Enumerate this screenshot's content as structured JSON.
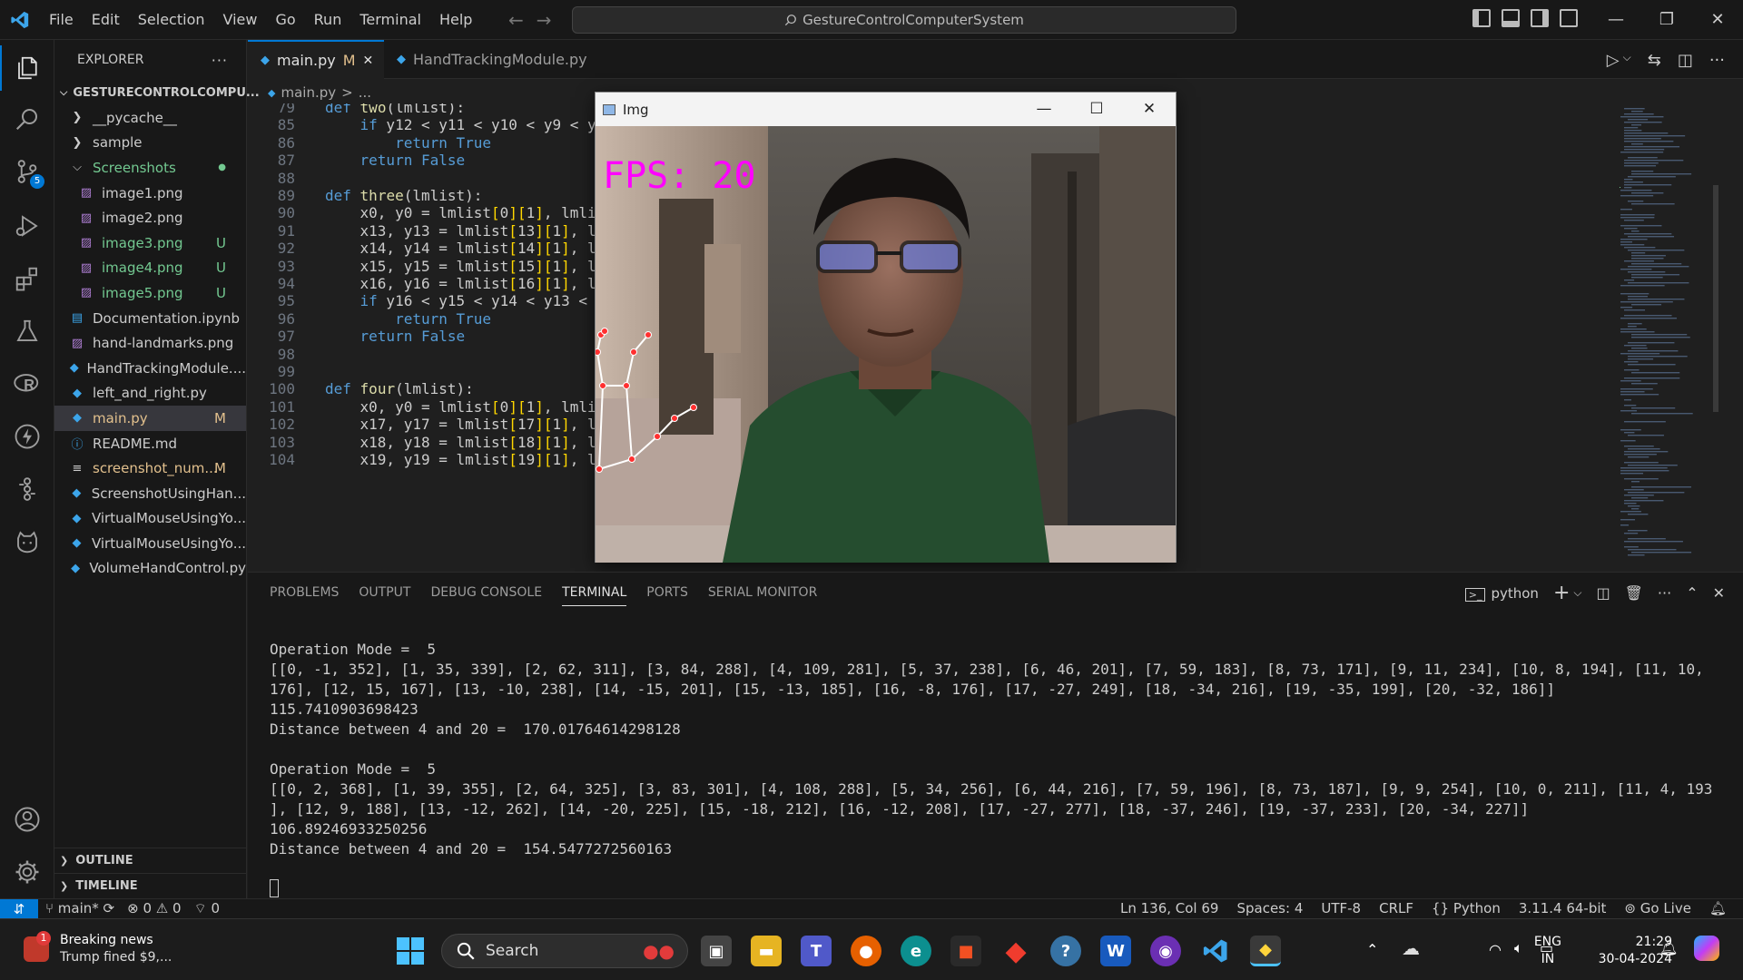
{
  "titlebar": {
    "menus": [
      "File",
      "Edit",
      "Selection",
      "View",
      "Go",
      "Run",
      "Terminal",
      "Help"
    ],
    "command_center": "GestureControlComputerSystem"
  },
  "activity_bar": {
    "icons": [
      "explorer-icon",
      "search-icon",
      "source-control-icon",
      "run-debug-icon",
      "extensions-icon",
      "testing-icon",
      "remote-r-icon",
      "thunder-icon",
      "git-graph-icon",
      "github-cat-icon",
      "account-icon",
      "settings-gear-icon"
    ],
    "source_control_badge": "5"
  },
  "sidebar": {
    "title": "EXPLORER",
    "more": "···",
    "folder": "GESTURECONTROLCOMPU...",
    "items": [
      {
        "label": "__pycache__",
        "type": "folder-collapsed",
        "depth": 1,
        "color": "#cccccc",
        "badge": ""
      },
      {
        "label": "sample",
        "type": "folder-collapsed",
        "depth": 1,
        "color": "#cccccc",
        "badge": ""
      },
      {
        "label": "Screenshots",
        "type": "folder-open",
        "depth": 1,
        "color": "#73c991",
        "badge": "●"
      },
      {
        "label": "image1.png",
        "type": "image",
        "depth": 2,
        "color": "#cccccc",
        "badge": ""
      },
      {
        "label": "image2.png",
        "type": "image",
        "depth": 2,
        "color": "#cccccc",
        "badge": ""
      },
      {
        "label": "image3.png",
        "type": "image",
        "depth": 2,
        "color": "#73c991",
        "badge": "U"
      },
      {
        "label": "image4.png",
        "type": "image",
        "depth": 2,
        "color": "#73c991",
        "badge": "U"
      },
      {
        "label": "image5.png",
        "type": "image",
        "depth": 2,
        "color": "#73c991",
        "badge": "U"
      },
      {
        "label": "Documentation.ipynb",
        "type": "notebook",
        "depth": 1,
        "color": "#cccccc",
        "badge": ""
      },
      {
        "label": "hand-landmarks.png",
        "type": "image",
        "depth": 1,
        "color": "#cccccc",
        "badge": ""
      },
      {
        "label": "HandTrackingModule....",
        "type": "python",
        "depth": 1,
        "color": "#cccccc",
        "badge": ""
      },
      {
        "label": "left_and_right.py",
        "type": "python",
        "depth": 1,
        "color": "#cccccc",
        "badge": ""
      },
      {
        "label": "main.py",
        "type": "python",
        "depth": 1,
        "color": "#e2c08d",
        "badge": "M",
        "active": true
      },
      {
        "label": "README.md",
        "type": "info",
        "depth": 1,
        "color": "#cccccc",
        "badge": ""
      },
      {
        "label": "screenshot_num...",
        "type": "text",
        "depth": 1,
        "color": "#e2c08d",
        "badge": "M"
      },
      {
        "label": "ScreenshotUsingHan...",
        "type": "python",
        "depth": 1,
        "color": "#cccccc",
        "badge": ""
      },
      {
        "label": "VirtualMouseUsingYo...",
        "type": "python",
        "depth": 1,
        "color": "#cccccc",
        "badge": ""
      },
      {
        "label": "VirtualMouseUsingYo...",
        "type": "python",
        "depth": 1,
        "color": "#cccccc",
        "badge": ""
      },
      {
        "label": "VolumeHandControl.py",
        "type": "python",
        "depth": 1,
        "color": "#cccccc",
        "badge": ""
      }
    ],
    "outline": "OUTLINE",
    "timeline": "TIMELINE"
  },
  "tabs": [
    {
      "label": "main.py",
      "modified": "M",
      "close": "✕",
      "active": true
    },
    {
      "label": "HandTrackingModule.py",
      "active": false
    }
  ],
  "breadcrumb": {
    "file": "main.py",
    "sep": ">",
    "rest": "..."
  },
  "code": {
    "lines": [
      {
        "n": "79",
        "text": "def two(lmlist):"
      },
      {
        "n": "85",
        "text": "    if y12 < y11 < y10 < y9 < y"
      },
      {
        "n": "86",
        "text": "        return True"
      },
      {
        "n": "87",
        "text": "    return False"
      },
      {
        "n": "88",
        "text": ""
      },
      {
        "n": "89",
        "text": "def three(lmlist):"
      },
      {
        "n": "90",
        "text": "    x0, y0 = lmlist[0][1], lmli"
      },
      {
        "n": "91",
        "text": "    x13, y13 = lmlist[13][1], l"
      },
      {
        "n": "92",
        "text": "    x14, y14 = lmlist[14][1], l"
      },
      {
        "n": "93",
        "text": "    x15, y15 = lmlist[15][1], l"
      },
      {
        "n": "94",
        "text": "    x16, y16 = lmlist[16][1], l"
      },
      {
        "n": "95",
        "text": "    if y16 < y15 < y14 < y13 <"
      },
      {
        "n": "96",
        "text": "        return True"
      },
      {
        "n": "97",
        "text": "    return False"
      },
      {
        "n": "98",
        "text": ""
      },
      {
        "n": "99",
        "text": ""
      },
      {
        "n": "100",
        "text": "def four(lmlist):"
      },
      {
        "n": "101",
        "text": "    x0, y0 = lmlist[0][1], lmli"
      },
      {
        "n": "102",
        "text": "    x17, y17 = lmlist[17][1], l"
      },
      {
        "n": "103",
        "text": "    x18, y18 = lmlist[18][1], l"
      },
      {
        "n": "104",
        "text": "    x19, y19 = lmlist[19][1], l"
      }
    ]
  },
  "img_window": {
    "title": "Img",
    "fps_overlay": "FPS: 20",
    "minimize": "—",
    "maximize": "☐",
    "close": "✕"
  },
  "panel": {
    "tabs": [
      "PROBLEMS",
      "OUTPUT",
      "DEBUG CONSOLE",
      "TERMINAL",
      "PORTS",
      "SERIAL MONITOR"
    ],
    "active_tab": "TERMINAL",
    "terminal_name": "python",
    "terminal_lines": [
      "Operation Mode =  5",
      "[[0, -1, 352], [1, 35, 339], [2, 62, 311], [3, 84, 288], [4, 109, 281], [5, 37, 238], [6, 46, 201], [7, 59, 183], [8, 73, 171], [9, 11, 234], [10, 8, 194], [11, 10,",
      "176], [12, 15, 167], [13, -10, 238], [14, -15, 201], [15, -13, 185], [16, -8, 176], [17, -27, 249], [18, -34, 216], [19, -35, 199], [20, -32, 186]]",
      "115.7410903698423",
      "Distance between 4 and 20 =  170.01764614298128",
      "",
      "Operation Mode =  5",
      "[[0, 2, 368], [1, 39, 355], [2, 64, 325], [3, 83, 301], [4, 108, 288], [5, 34, 256], [6, 44, 216], [7, 59, 196], [8, 73, 187], [9, 9, 254], [10, 0, 211], [11, 4, 193",
      "], [12, 9, 188], [13, -12, 262], [14, -20, 225], [15, -18, 212], [16, -12, 208], [17, -27, 277], [18, -37, 246], [19, -37, 233], [20, -34, 227]]",
      "106.89246933250256",
      "Distance between 4 and 20 =  154.5477272560163"
    ]
  },
  "statusbar": {
    "branch": "main*",
    "errors": "0",
    "warnings": "0",
    "ports": "0",
    "position": "Ln 136, Col 69",
    "spaces": "Spaces: 4",
    "encoding": "UTF-8",
    "eol": "CRLF",
    "language": "Python",
    "interpreter": "3.11.4 64-bit",
    "golive": "Go Live"
  },
  "taskbar": {
    "news_title": "Breaking news",
    "news_sub": "Trump fined $9,...",
    "news_badge": "1",
    "search": "Search",
    "lang1": "ENG",
    "lang2": "IN",
    "time": "21:29",
    "date": "30-04-2024",
    "apps": [
      "file-explorer-icon",
      "folder-icon",
      "teams-icon",
      "firefox-icon",
      "edge-icon",
      "store-icon",
      "git-icon",
      "python-idle-icon",
      "word-icon",
      "game-icon",
      "vscode-icon",
      "python-icon"
    ]
  }
}
